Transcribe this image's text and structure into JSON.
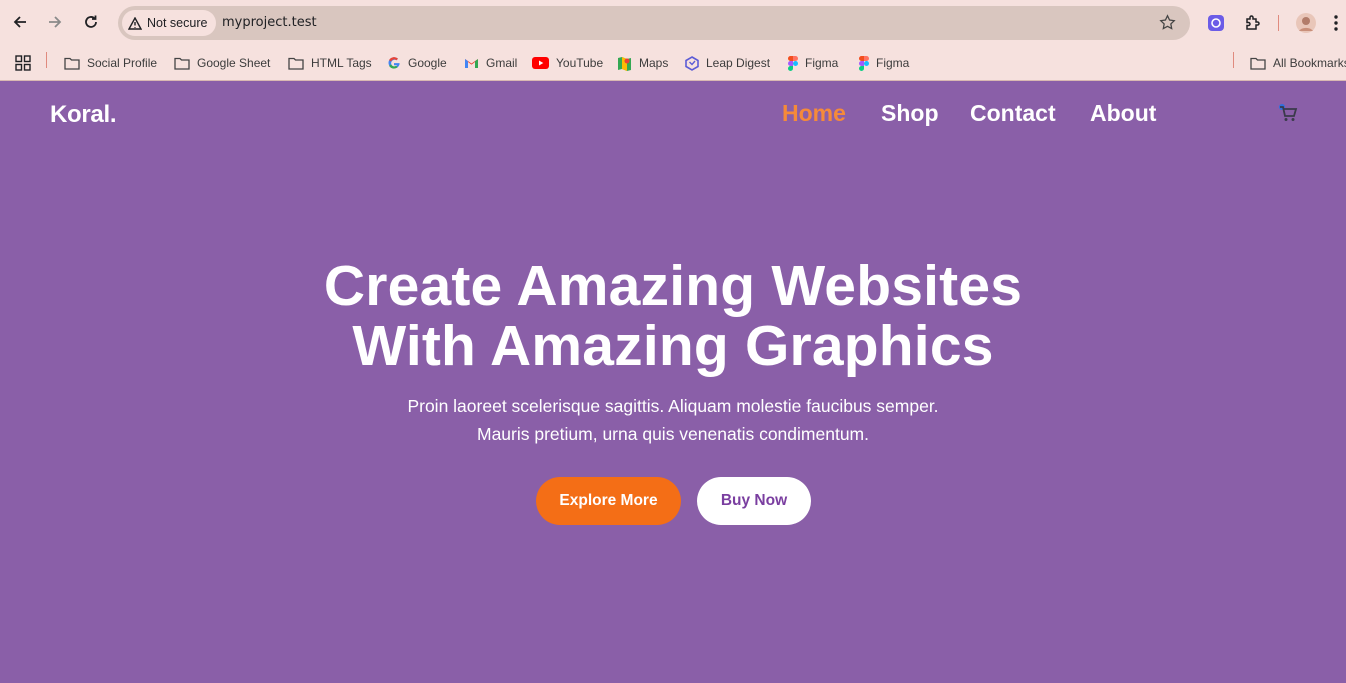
{
  "browser": {
    "security_label": "Not secure",
    "url": "myproject.test",
    "bookmarks": [
      {
        "label": "Social Profile",
        "icon": "folder-icon"
      },
      {
        "label": "Google Sheet",
        "icon": "folder-icon"
      },
      {
        "label": "HTML Tags",
        "icon": "folder-icon"
      },
      {
        "label": "Google",
        "icon": "google-icon"
      },
      {
        "label": "Gmail",
        "icon": "gmail-icon"
      },
      {
        "label": "YouTube",
        "icon": "youtube-icon"
      },
      {
        "label": "Maps",
        "icon": "maps-icon"
      },
      {
        "label": "Leap Digest",
        "icon": "leap-digest-icon"
      },
      {
        "label": "Figma",
        "icon": "figma-icon"
      },
      {
        "label": "Figma",
        "icon": "figma-icon"
      }
    ],
    "all_bookmarks": "All Bookmarks"
  },
  "site": {
    "logo": "Koral.",
    "nav": [
      "Home",
      "Shop",
      "Contact",
      "About"
    ],
    "active_nav": "Home",
    "hero": {
      "title_line1": "Create Amazing Websites",
      "title_line2": "With Amazing Graphics",
      "subtitle_line1": "Proin laoreet scelerisque sagittis. Aliquam molestie faucibus semper.",
      "subtitle_line2": "Mauris pretium, urna quis venenatis condimentum."
    },
    "buttons": {
      "explore": "Explore More",
      "buy": "Buy Now"
    }
  },
  "colors": {
    "background": "#8a5fa8",
    "accent": "#f46e16",
    "active_nav": "#f58a3a",
    "browser_chrome": "#f6e1de"
  }
}
